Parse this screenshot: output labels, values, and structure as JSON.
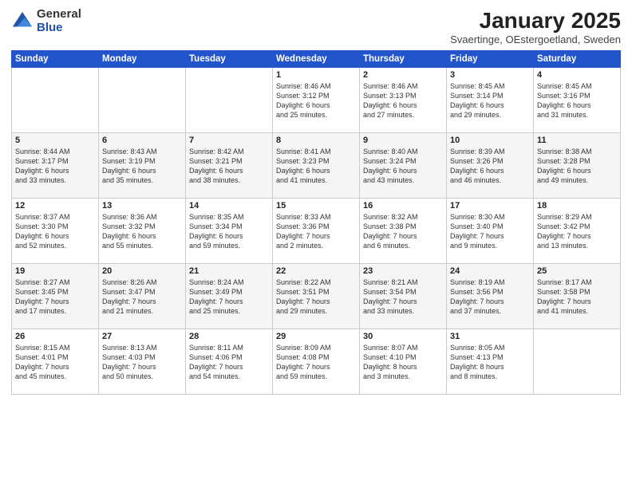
{
  "logo": {
    "general": "General",
    "blue": "Blue"
  },
  "title": "January 2025",
  "subtitle": "Svaertinge, OEstergoetland, Sweden",
  "days_of_week": [
    "Sunday",
    "Monday",
    "Tuesday",
    "Wednesday",
    "Thursday",
    "Friday",
    "Saturday"
  ],
  "weeks": [
    [
      {
        "day": "",
        "info": ""
      },
      {
        "day": "",
        "info": ""
      },
      {
        "day": "",
        "info": ""
      },
      {
        "day": "1",
        "info": "Sunrise: 8:46 AM\nSunset: 3:12 PM\nDaylight: 6 hours\nand 25 minutes."
      },
      {
        "day": "2",
        "info": "Sunrise: 8:46 AM\nSunset: 3:13 PM\nDaylight: 6 hours\nand 27 minutes."
      },
      {
        "day": "3",
        "info": "Sunrise: 8:45 AM\nSunset: 3:14 PM\nDaylight: 6 hours\nand 29 minutes."
      },
      {
        "day": "4",
        "info": "Sunrise: 8:45 AM\nSunset: 3:16 PM\nDaylight: 6 hours\nand 31 minutes."
      }
    ],
    [
      {
        "day": "5",
        "info": "Sunrise: 8:44 AM\nSunset: 3:17 PM\nDaylight: 6 hours\nand 33 minutes."
      },
      {
        "day": "6",
        "info": "Sunrise: 8:43 AM\nSunset: 3:19 PM\nDaylight: 6 hours\nand 35 minutes."
      },
      {
        "day": "7",
        "info": "Sunrise: 8:42 AM\nSunset: 3:21 PM\nDaylight: 6 hours\nand 38 minutes."
      },
      {
        "day": "8",
        "info": "Sunrise: 8:41 AM\nSunset: 3:23 PM\nDaylight: 6 hours\nand 41 minutes."
      },
      {
        "day": "9",
        "info": "Sunrise: 8:40 AM\nSunset: 3:24 PM\nDaylight: 6 hours\nand 43 minutes."
      },
      {
        "day": "10",
        "info": "Sunrise: 8:39 AM\nSunset: 3:26 PM\nDaylight: 6 hours\nand 46 minutes."
      },
      {
        "day": "11",
        "info": "Sunrise: 8:38 AM\nSunset: 3:28 PM\nDaylight: 6 hours\nand 49 minutes."
      }
    ],
    [
      {
        "day": "12",
        "info": "Sunrise: 8:37 AM\nSunset: 3:30 PM\nDaylight: 6 hours\nand 52 minutes."
      },
      {
        "day": "13",
        "info": "Sunrise: 8:36 AM\nSunset: 3:32 PM\nDaylight: 6 hours\nand 55 minutes."
      },
      {
        "day": "14",
        "info": "Sunrise: 8:35 AM\nSunset: 3:34 PM\nDaylight: 6 hours\nand 59 minutes."
      },
      {
        "day": "15",
        "info": "Sunrise: 8:33 AM\nSunset: 3:36 PM\nDaylight: 7 hours\nand 2 minutes."
      },
      {
        "day": "16",
        "info": "Sunrise: 8:32 AM\nSunset: 3:38 PM\nDaylight: 7 hours\nand 6 minutes."
      },
      {
        "day": "17",
        "info": "Sunrise: 8:30 AM\nSunset: 3:40 PM\nDaylight: 7 hours\nand 9 minutes."
      },
      {
        "day": "18",
        "info": "Sunrise: 8:29 AM\nSunset: 3:42 PM\nDaylight: 7 hours\nand 13 minutes."
      }
    ],
    [
      {
        "day": "19",
        "info": "Sunrise: 8:27 AM\nSunset: 3:45 PM\nDaylight: 7 hours\nand 17 minutes."
      },
      {
        "day": "20",
        "info": "Sunrise: 8:26 AM\nSunset: 3:47 PM\nDaylight: 7 hours\nand 21 minutes."
      },
      {
        "day": "21",
        "info": "Sunrise: 8:24 AM\nSunset: 3:49 PM\nDaylight: 7 hours\nand 25 minutes."
      },
      {
        "day": "22",
        "info": "Sunrise: 8:22 AM\nSunset: 3:51 PM\nDaylight: 7 hours\nand 29 minutes."
      },
      {
        "day": "23",
        "info": "Sunrise: 8:21 AM\nSunset: 3:54 PM\nDaylight: 7 hours\nand 33 minutes."
      },
      {
        "day": "24",
        "info": "Sunrise: 8:19 AM\nSunset: 3:56 PM\nDaylight: 7 hours\nand 37 minutes."
      },
      {
        "day": "25",
        "info": "Sunrise: 8:17 AM\nSunset: 3:58 PM\nDaylight: 7 hours\nand 41 minutes."
      }
    ],
    [
      {
        "day": "26",
        "info": "Sunrise: 8:15 AM\nSunset: 4:01 PM\nDaylight: 7 hours\nand 45 minutes."
      },
      {
        "day": "27",
        "info": "Sunrise: 8:13 AM\nSunset: 4:03 PM\nDaylight: 7 hours\nand 50 minutes."
      },
      {
        "day": "28",
        "info": "Sunrise: 8:11 AM\nSunset: 4:06 PM\nDaylight: 7 hours\nand 54 minutes."
      },
      {
        "day": "29",
        "info": "Sunrise: 8:09 AM\nSunset: 4:08 PM\nDaylight: 7 hours\nand 59 minutes."
      },
      {
        "day": "30",
        "info": "Sunrise: 8:07 AM\nSunset: 4:10 PM\nDaylight: 8 hours\nand 3 minutes."
      },
      {
        "day": "31",
        "info": "Sunrise: 8:05 AM\nSunset: 4:13 PM\nDaylight: 8 hours\nand 8 minutes."
      },
      {
        "day": "",
        "info": ""
      }
    ]
  ]
}
